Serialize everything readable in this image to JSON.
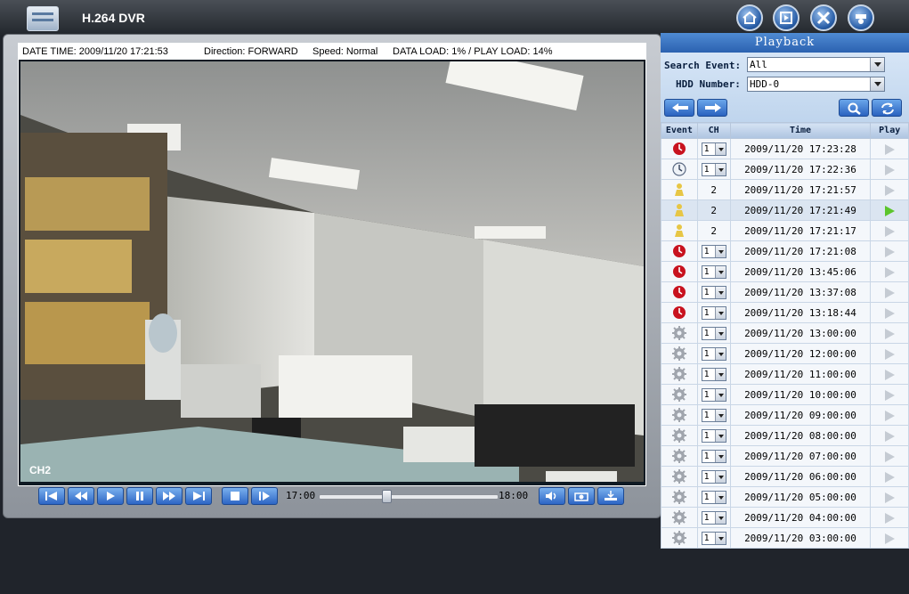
{
  "app": {
    "title": "H.264 DVR"
  },
  "topbar": {
    "icons": [
      "home-icon",
      "playback-icon",
      "settings-icon",
      "camera-icon"
    ]
  },
  "status": {
    "datetime": "DATE TIME: 2009/11/20 17:21:53",
    "direction": "Direction: FORWARD",
    "speed": "Speed: Normal",
    "load": "DATA LOAD: 1% / PLAY LOAD: 14%"
  },
  "video": {
    "channel": "CH2"
  },
  "timeline": {
    "start": "17:00",
    "end": "18:00",
    "position_fraction": 0.37
  },
  "playback": {
    "title": "Playback",
    "search_event_label": "Search Event:",
    "search_event_value": "All",
    "hdd_label": "HDD Number:",
    "hdd_value": "HDD-0",
    "columns": [
      "Event",
      "CH",
      "Time",
      "Play"
    ],
    "rows": [
      {
        "type": "alarm",
        "ch": "1",
        "ch_select": true,
        "time": "2009/11/20 17:23:28",
        "active": false
      },
      {
        "type": "schedule",
        "ch": "1",
        "ch_select": true,
        "time": "2009/11/20 17:22:36",
        "active": false
      },
      {
        "type": "motion",
        "ch": "2",
        "ch_select": false,
        "time": "2009/11/20 17:21:57",
        "active": false
      },
      {
        "type": "motion",
        "ch": "2",
        "ch_select": false,
        "time": "2009/11/20 17:21:49",
        "active": true
      },
      {
        "type": "motion",
        "ch": "2",
        "ch_select": false,
        "time": "2009/11/20 17:21:17",
        "active": false
      },
      {
        "type": "alarm",
        "ch": "1",
        "ch_select": true,
        "time": "2009/11/20 17:21:08",
        "active": false
      },
      {
        "type": "alarm",
        "ch": "1",
        "ch_select": true,
        "time": "2009/11/20 13:45:06",
        "active": false
      },
      {
        "type": "alarm",
        "ch": "1",
        "ch_select": true,
        "time": "2009/11/20 13:37:08",
        "active": false
      },
      {
        "type": "alarm",
        "ch": "1",
        "ch_select": true,
        "time": "2009/11/20 13:18:44",
        "active": false
      },
      {
        "type": "system",
        "ch": "1",
        "ch_select": true,
        "time": "2009/11/20 13:00:00",
        "active": false
      },
      {
        "type": "system",
        "ch": "1",
        "ch_select": true,
        "time": "2009/11/20 12:00:00",
        "active": false
      },
      {
        "type": "system",
        "ch": "1",
        "ch_select": true,
        "time": "2009/11/20 11:00:00",
        "active": false
      },
      {
        "type": "system",
        "ch": "1",
        "ch_select": true,
        "time": "2009/11/20 10:00:00",
        "active": false
      },
      {
        "type": "system",
        "ch": "1",
        "ch_select": true,
        "time": "2009/11/20 09:00:00",
        "active": false
      },
      {
        "type": "system",
        "ch": "1",
        "ch_select": true,
        "time": "2009/11/20 08:00:00",
        "active": false
      },
      {
        "type": "system",
        "ch": "1",
        "ch_select": true,
        "time": "2009/11/20 07:00:00",
        "active": false
      },
      {
        "type": "system",
        "ch": "1",
        "ch_select": true,
        "time": "2009/11/20 06:00:00",
        "active": false
      },
      {
        "type": "system",
        "ch": "1",
        "ch_select": true,
        "time": "2009/11/20 05:00:00",
        "active": false
      },
      {
        "type": "system",
        "ch": "1",
        "ch_select": true,
        "time": "2009/11/20 04:00:00",
        "active": false
      },
      {
        "type": "system",
        "ch": "1",
        "ch_select": true,
        "time": "2009/11/20 03:00:00",
        "active": false
      }
    ]
  }
}
